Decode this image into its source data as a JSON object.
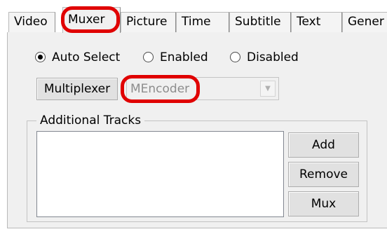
{
  "tabs": [
    {
      "label": "Video",
      "active": false
    },
    {
      "label": "Muxer",
      "active": true
    },
    {
      "label": "Picture",
      "active": false
    },
    {
      "label": "Time",
      "active": false
    },
    {
      "label": "Subtitle",
      "active": false
    },
    {
      "label": "Text",
      "active": false
    },
    {
      "label": "Gener",
      "active": false
    }
  ],
  "mode": {
    "options": [
      {
        "label": "Auto Select",
        "checked": true
      },
      {
        "label": "Enabled",
        "checked": false
      },
      {
        "label": "Disabled",
        "checked": false
      }
    ]
  },
  "multiplexer": {
    "button_label": "Multiplexer",
    "selected_value": "MEncoder",
    "disabled": true
  },
  "additional_tracks": {
    "group_label": "Additional Tracks",
    "items": [],
    "buttons": {
      "add": "Add",
      "remove": "Remove",
      "mux": "Mux"
    }
  },
  "annotation_color": "#e00000"
}
